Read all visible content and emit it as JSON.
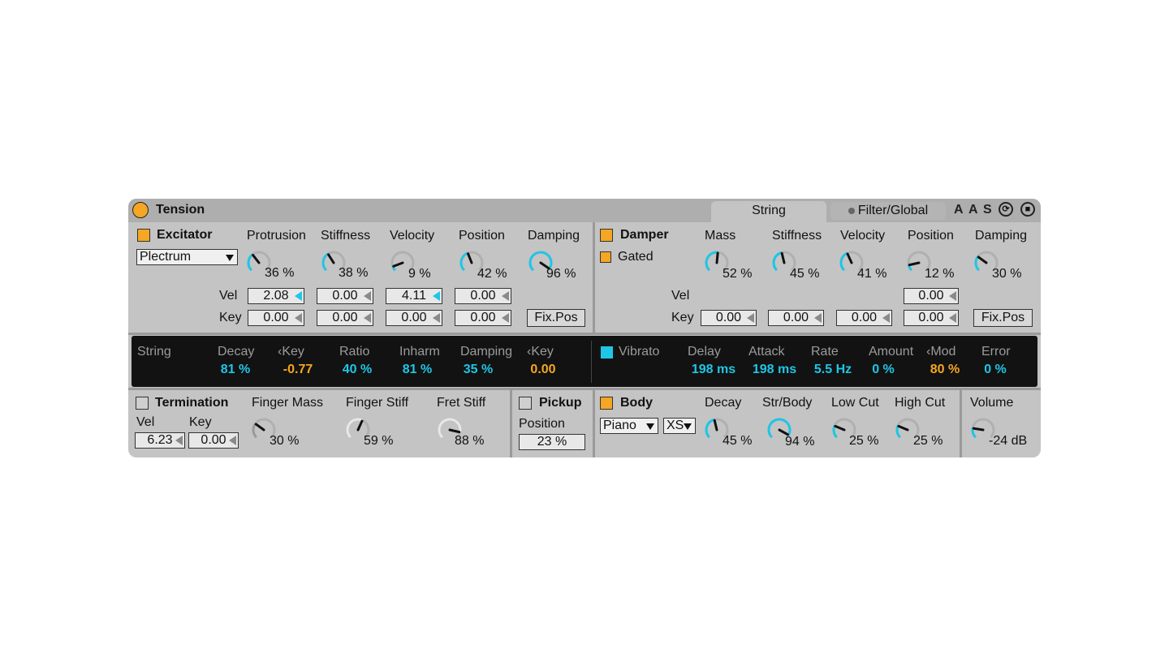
{
  "colors": {
    "accent": "#f5a623",
    "value": "#1ec6e6",
    "panel": "#c4c4c4",
    "dark": "#121212"
  },
  "device": {
    "name": "Tension"
  },
  "tabs": {
    "string": "String",
    "filter": "Filter/Global"
  },
  "top_icons": [
    "A",
    "A",
    "S"
  ],
  "excitator": {
    "title": "Excitator",
    "type": "Plectrum",
    "knob_labels": [
      "Protrusion",
      "Stiffness",
      "Velocity",
      "Position",
      "Damping"
    ],
    "knob_values": [
      "36 %",
      "38 %",
      "9 %",
      "42 %",
      "96 %"
    ],
    "knob_levels": [
      0.36,
      0.38,
      0.09,
      0.42,
      0.96
    ],
    "vel_label": "Vel",
    "key_label": "Key",
    "vel": [
      "2.08",
      "0.00",
      "4.11",
      "0.00"
    ],
    "key": [
      "0.00",
      "0.00",
      "0.00",
      "0.00"
    ],
    "fixpos": "Fix.Pos"
  },
  "damper": {
    "title": "Damper",
    "gated": "Gated",
    "knob_labels": [
      "Mass",
      "Stiffness",
      "Velocity",
      "Position",
      "Damping"
    ],
    "knob_values": [
      "52 %",
      "45 %",
      "41 %",
      "12 %",
      "30 %"
    ],
    "knob_levels": [
      0.52,
      0.45,
      0.41,
      0.12,
      0.3
    ],
    "vel_label": "Vel",
    "key_label": "Key",
    "vel_pos": "0.00",
    "key": [
      "0.00",
      "0.00",
      "0.00",
      "0.00"
    ],
    "fixpos": "Fix.Pos"
  },
  "string": {
    "title": "String",
    "params": [
      {
        "label": "Decay",
        "value": "81 %"
      },
      {
        "label": "‹Key",
        "value": "-0.77"
      },
      {
        "label": "Ratio",
        "value": "40 %"
      },
      {
        "label": "Inharm",
        "value": "81 %"
      },
      {
        "label": "Damping",
        "value": "35 %"
      },
      {
        "label": "‹Key",
        "value": "0.00"
      }
    ]
  },
  "vibrato": {
    "title": "Vibrato",
    "params": [
      {
        "label": "Delay",
        "value": "198 ms"
      },
      {
        "label": "Attack",
        "value": "198 ms"
      },
      {
        "label": "Rate",
        "value": "5.5 Hz"
      },
      {
        "label": "Amount",
        "value": "0 %"
      },
      {
        "label": "‹Mod",
        "value": "80 %"
      },
      {
        "label": "Error",
        "value": "0 %"
      }
    ]
  },
  "termination": {
    "title": "Termination",
    "vel_label": "Vel",
    "key_label": "Key",
    "vel": "6.23",
    "key": "0.00",
    "knob_labels": [
      "Finger Mass",
      "Finger Stiff",
      "Fret Stiff"
    ],
    "knob_values": [
      "30 %",
      "59 %",
      "88 %"
    ],
    "knob_levels": [
      0.3,
      0.59,
      0.88
    ]
  },
  "pickup": {
    "title": "Pickup",
    "position_label": "Position",
    "position": "23 %"
  },
  "body": {
    "title": "Body",
    "type": "Piano",
    "size": "XS",
    "knob_labels": [
      "Decay",
      "Str/Body",
      "Low Cut",
      "High Cut"
    ],
    "knob_values": [
      "45 %",
      "94 %",
      "25 %",
      "25 %"
    ],
    "knob_levels": [
      0.45,
      0.94,
      0.25,
      0.25
    ]
  },
  "volume": {
    "label": "Volume",
    "value": "-24 dB",
    "level": 0.2
  }
}
